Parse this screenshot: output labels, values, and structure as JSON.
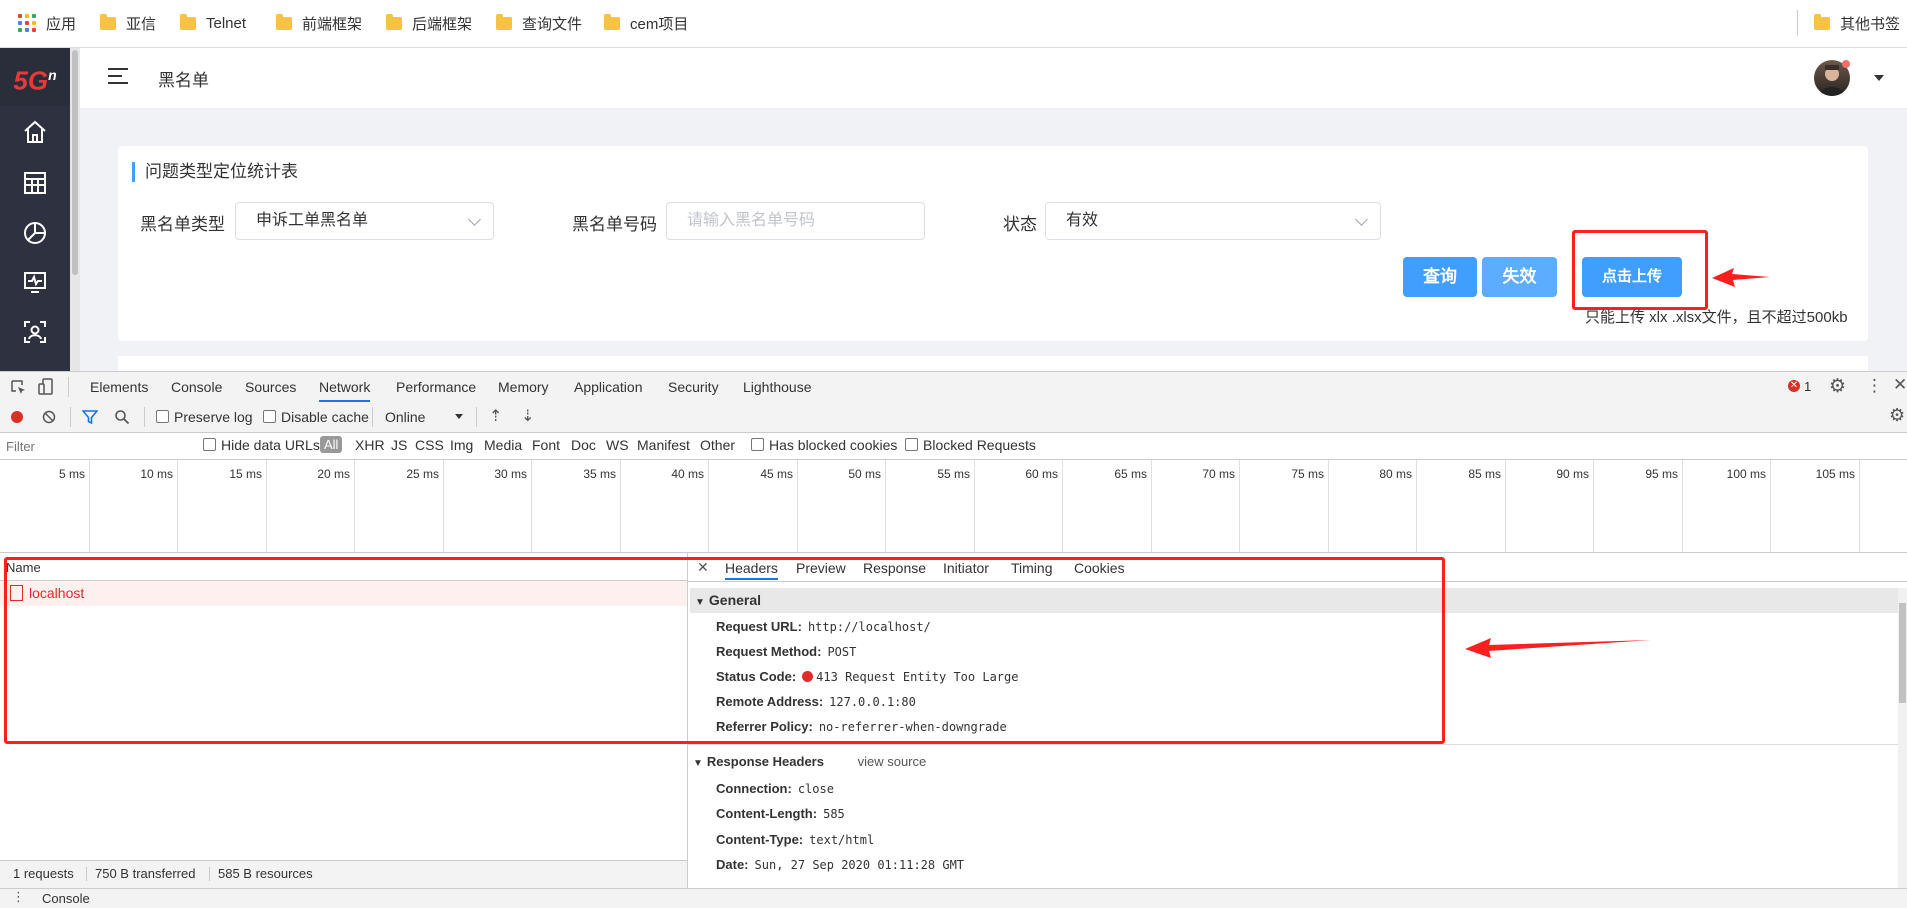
{
  "bookmarks": {
    "apps_label": "应用",
    "items": [
      "亚信",
      "Telnet",
      "前端框架",
      "后端框架",
      "查询文件",
      "cem项目"
    ],
    "other": "其他书签"
  },
  "sidebar": {
    "logo": "5G",
    "logo_sup": "n",
    "icons": [
      "home-icon",
      "table-icon",
      "pie-chart-icon",
      "monitor-icon",
      "user-card-icon"
    ]
  },
  "header": {
    "page_title": "黑名单"
  },
  "card": {
    "title": "问题类型定位统计表",
    "blacklist_type_label": "黑名单类型",
    "blacklist_type_value": "申诉工单黑名单",
    "blacklist_no_label": "黑名单号码",
    "blacklist_no_placeholder": "请输入黑名单号码",
    "status_label": "状态",
    "status_value": "有效",
    "query_button": "查询",
    "invalidate_button": "失效",
    "upload_button": "点击上传",
    "upload_hint": "只能上传 xlx .xlsx文件，且不超过500kb"
  },
  "devtools": {
    "tabs": [
      "Elements",
      "Console",
      "Sources",
      "Network",
      "Performance",
      "Memory",
      "Application",
      "Security",
      "Lighthouse"
    ],
    "active_tab": "Network",
    "error_count": "1",
    "toolbar": {
      "preserve_log": "Preserve log",
      "disable_cache": "Disable cache",
      "throttle": "Online"
    },
    "filter": {
      "placeholder": "Filter",
      "hide_data_urls": "Hide data URLs",
      "types": [
        "All",
        "XHR",
        "JS",
        "CSS",
        "Img",
        "Media",
        "Font",
        "Doc",
        "WS",
        "Manifest",
        "Other"
      ],
      "has_blocked_cookies": "Has blocked cookies",
      "blocked_requests": "Blocked Requests"
    },
    "timeline_ticks": [
      "5 ms",
      "10 ms",
      "15 ms",
      "20 ms",
      "25 ms",
      "30 ms",
      "35 ms",
      "40 ms",
      "45 ms",
      "50 ms",
      "55 ms",
      "60 ms",
      "65 ms",
      "70 ms",
      "75 ms",
      "80 ms",
      "85 ms",
      "90 ms",
      "95 ms",
      "100 ms",
      "105 ms"
    ],
    "requests": {
      "name_header": "Name",
      "rows": [
        "localhost"
      ],
      "footer": [
        "1 requests",
        "750 B transferred",
        "585 B resources"
      ]
    },
    "details": {
      "tabs": [
        "Headers",
        "Preview",
        "Response",
        "Initiator",
        "Timing",
        "Cookies"
      ],
      "general_title": "General",
      "general": [
        {
          "k": "Request URL:",
          "v": "http://localhost/"
        },
        {
          "k": "Request Method:",
          "v": "POST"
        },
        {
          "k": "Status Code:",
          "v": "413 Request Entity Too Large"
        },
        {
          "k": "Remote Address:",
          "v": "127.0.0.1:80"
        },
        {
          "k": "Referrer Policy:",
          "v": "no-referrer-when-downgrade"
        }
      ],
      "response_headers_title": "Response Headers",
      "view_source": "view source",
      "response": [
        {
          "k": "Connection:",
          "v": "close"
        },
        {
          "k": "Content-Length:",
          "v": "585"
        },
        {
          "k": "Content-Type:",
          "v": "text/html"
        },
        {
          "k": "Date:",
          "v": "Sun, 27 Sep 2020 01:11:28 GMT"
        }
      ]
    },
    "drawer": "Console"
  },
  "colors": {
    "primary": "#409eff",
    "annotation_red": "#ff1f1f",
    "sidebar_bg": "#2e3240"
  }
}
